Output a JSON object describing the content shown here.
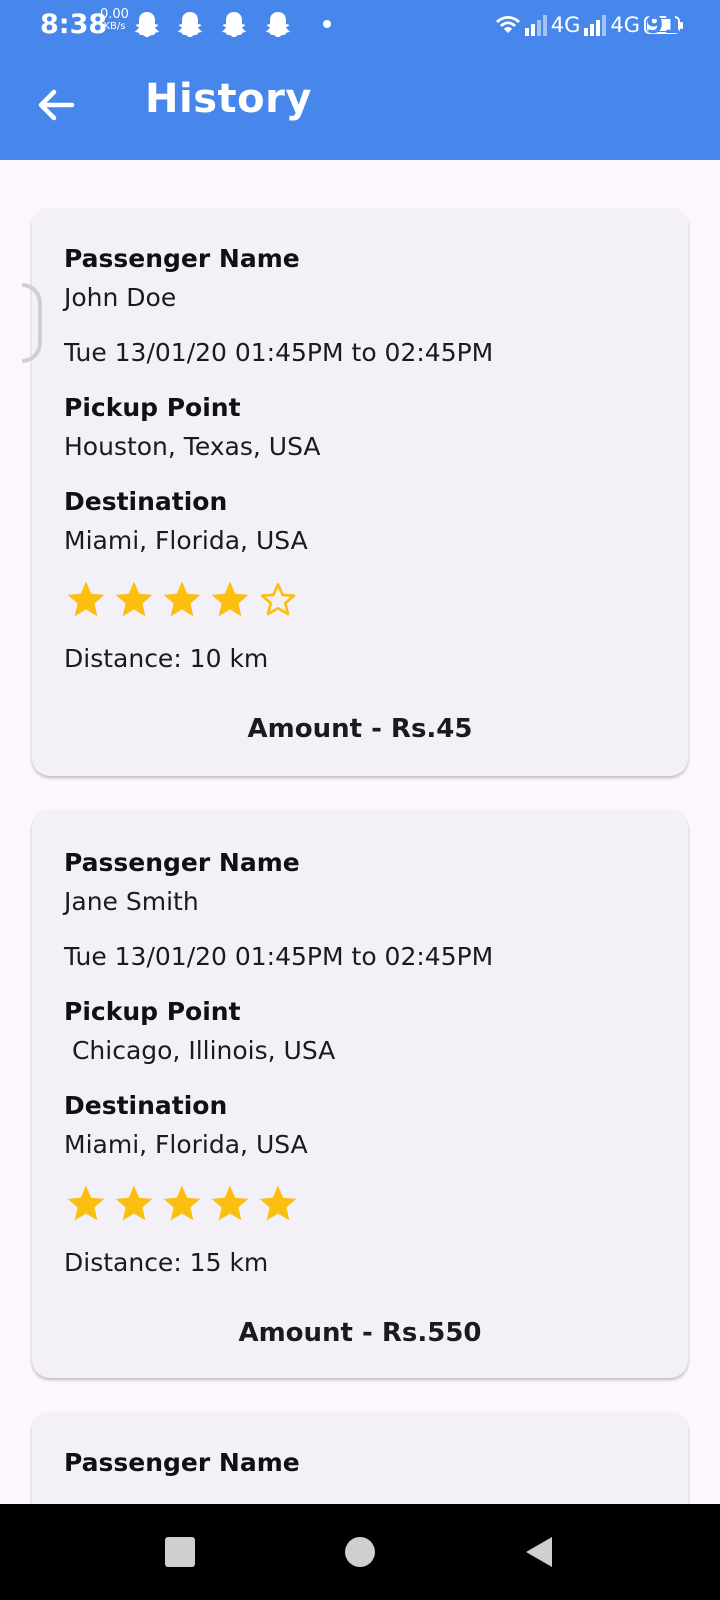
{
  "status_bar": {
    "time": "8:38",
    "net_speed_value": "0.00",
    "net_speed_unit": "KB/s",
    "notification_icons": [
      "snapchat-icon",
      "snapchat-icon",
      "snapchat-icon",
      "snapchat-icon",
      "dot-icon"
    ],
    "network_1": "4G",
    "network_2": "4G",
    "battery": "91"
  },
  "app_bar": {
    "title": "History",
    "back_icon": "arrow-left-icon"
  },
  "labels": {
    "passenger_name": "Passenger Name",
    "pickup_point": "Pickup Point",
    "destination": "Destination"
  },
  "rides": [
    {
      "passenger_name": "John Doe",
      "time_range": "Tue 13/01/20 01:45PM to 02:45PM",
      "pickup_point": "Houston, Texas, USA",
      "destination": "Miami, Florida, USA",
      "rating": 4,
      "rating_max": 5,
      "distance": "Distance: 10 km",
      "amount": "Amount - Rs.45"
    },
    {
      "passenger_name": "Jane Smith",
      "time_range": "Tue 13/01/20 01:45PM to 02:45PM",
      "pickup_point": " Chicago, Illinois, USA",
      "destination": "Miami, Florida, USA",
      "rating": 5,
      "rating_max": 5,
      "distance": "Distance: 15 km",
      "amount": "Amount - Rs.550"
    },
    {
      "passenger_name_label": "Passenger Name"
    }
  ],
  "colors": {
    "app_bar": "#4787ec",
    "background": "#fcf7fd",
    "card": "#f4f0f7",
    "star": "#fbbf11",
    "nav_bar": "#000000"
  },
  "nav_bar": {
    "icons": [
      "recents-square-icon",
      "home-circle-icon",
      "back-triangle-icon"
    ]
  }
}
